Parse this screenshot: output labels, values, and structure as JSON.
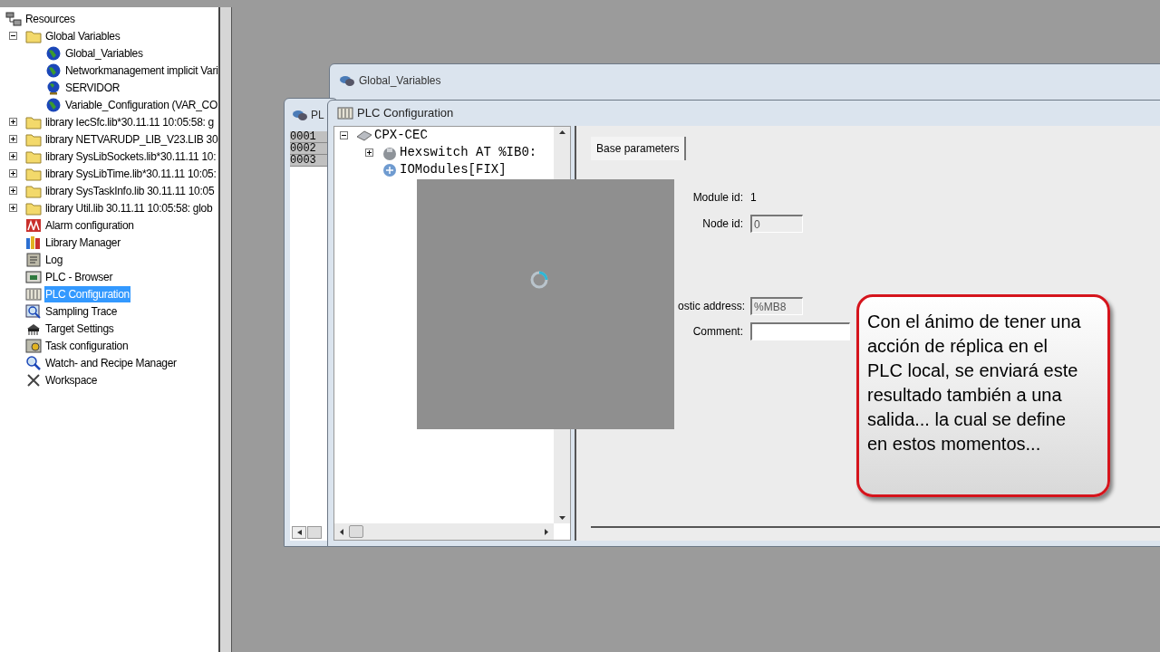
{
  "resources_tree": {
    "label": "Resources",
    "children": [
      {
        "label": "Global Variables",
        "kind": "folder",
        "expanded": true,
        "selected": false,
        "children": [
          {
            "label": "Global_Variables",
            "kind": "globe",
            "selected": false
          },
          {
            "label": "Networkmanagement implicit Vari",
            "kind": "globe",
            "selected": false
          },
          {
            "label": "SERVIDOR",
            "kind": "globe-stand",
            "selected": false
          },
          {
            "label": "Variable_Configuration (VAR_CO",
            "kind": "globe",
            "selected": false
          }
        ]
      },
      {
        "label": "library IecSfc.lib*30.11.11 10:05:58: g",
        "kind": "folder",
        "expanded": false,
        "selected": false
      },
      {
        "label": "library NETVARUDP_LIB_V23.LIB 30",
        "kind": "folder",
        "expanded": false,
        "selected": false
      },
      {
        "label": "library SysLibSockets.lib*30.11.11 10:",
        "kind": "folder",
        "expanded": false,
        "selected": false
      },
      {
        "label": "library SysLibTime.lib*30.11.11 10:05:",
        "kind": "folder",
        "expanded": false,
        "selected": false
      },
      {
        "label": "library SysTaskInfo.lib 30.11.11 10:05",
        "kind": "folder",
        "expanded": false,
        "selected": false
      },
      {
        "label": "library Util.lib 30.11.11 10:05:58: glob",
        "kind": "folder",
        "expanded": false,
        "selected": false
      },
      {
        "label": "Alarm configuration",
        "kind": "alarm",
        "selected": false
      },
      {
        "label": "Library Manager",
        "kind": "books",
        "selected": false
      },
      {
        "label": "Log",
        "kind": "log",
        "selected": false
      },
      {
        "label": "PLC - Browser",
        "kind": "monitor",
        "selected": false
      },
      {
        "label": "PLC Configuration",
        "kind": "rack",
        "selected": true
      },
      {
        "label": "Sampling Trace",
        "kind": "trace",
        "selected": false
      },
      {
        "label": "Target Settings",
        "kind": "chip",
        "selected": false
      },
      {
        "label": "Task configuration",
        "kind": "task",
        "selected": false
      },
      {
        "label": "Watch- and Recipe Manager",
        "kind": "magnifier",
        "selected": false
      },
      {
        "label": "Workspace",
        "kind": "tools",
        "selected": false
      }
    ]
  },
  "global_variables_window": {
    "title": "Global_Variables"
  },
  "plc_window": {
    "title": "PL",
    "line_numbers": [
      "0001",
      "0002",
      "0003"
    ]
  },
  "plc_configuration_window": {
    "title": "PLC Configuration",
    "tree": {
      "label": "CPX-CEC",
      "kind": "controller",
      "expanded": true,
      "children": [
        {
          "label": "Hexswitch AT %IB0:",
          "kind": "switch",
          "expanded": false
        },
        {
          "label": "IOModules[FIX]",
          "kind": "module"
        }
      ]
    },
    "tabs": [
      {
        "label": "Base parameters",
        "selected": true
      }
    ],
    "fields": [
      {
        "kind": "readout",
        "label": "Module id:",
        "value": "1"
      },
      {
        "kind": "input",
        "label": "Node id:",
        "value": "0",
        "disabled": true
      },
      {
        "kind": "input",
        "label": "ostic address:",
        "value": "%MB8",
        "disabled": true
      },
      {
        "kind": "input",
        "label": "Comment:",
        "disabled": false
      }
    ]
  },
  "callout": {
    "text": "Con el ánimo de tener una acción de réplica en el PLC local, se enviará este resultado también a una salida... la cual se define en estos momentos..."
  }
}
